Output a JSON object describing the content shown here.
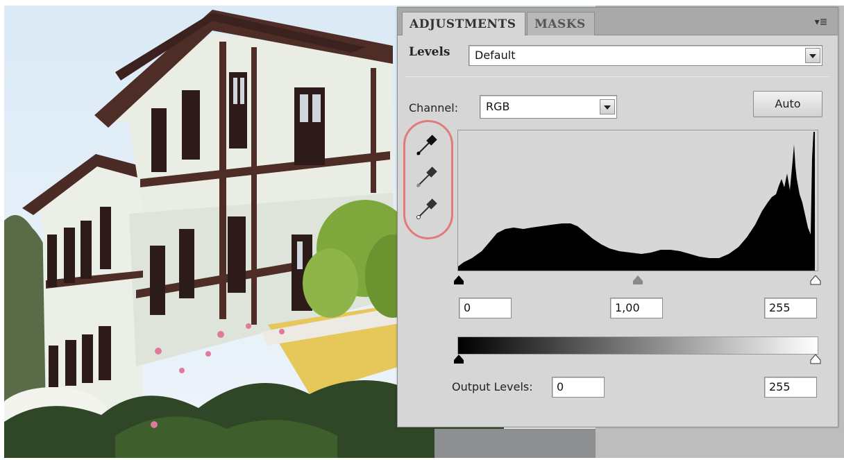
{
  "tabs": [
    {
      "label": "ADJUSTMENTS",
      "active": true
    },
    {
      "label": "MASKS",
      "active": false
    }
  ],
  "panel_menu_icon": "panel-menu-icon",
  "levels": {
    "label": "Levels",
    "preset_value": "Default",
    "channel_label": "Channel:",
    "channel_value": "RGB",
    "auto_label": "Auto"
  },
  "eyedroppers": [
    "black-point-eyedropper-icon",
    "gray-point-eyedropper-icon",
    "white-point-eyedropper-icon"
  ],
  "input_levels": {
    "black": "0",
    "gamma": "1,00",
    "white": "255"
  },
  "output_levels": {
    "label": "Output Levels:",
    "black": "0",
    "white": "255"
  },
  "colors": {
    "panel_bg": "#d6d6d6",
    "tab_bar": "#a9a9a9",
    "highlight_circle": "#e27a7a",
    "histogram_fill": "#000000"
  }
}
